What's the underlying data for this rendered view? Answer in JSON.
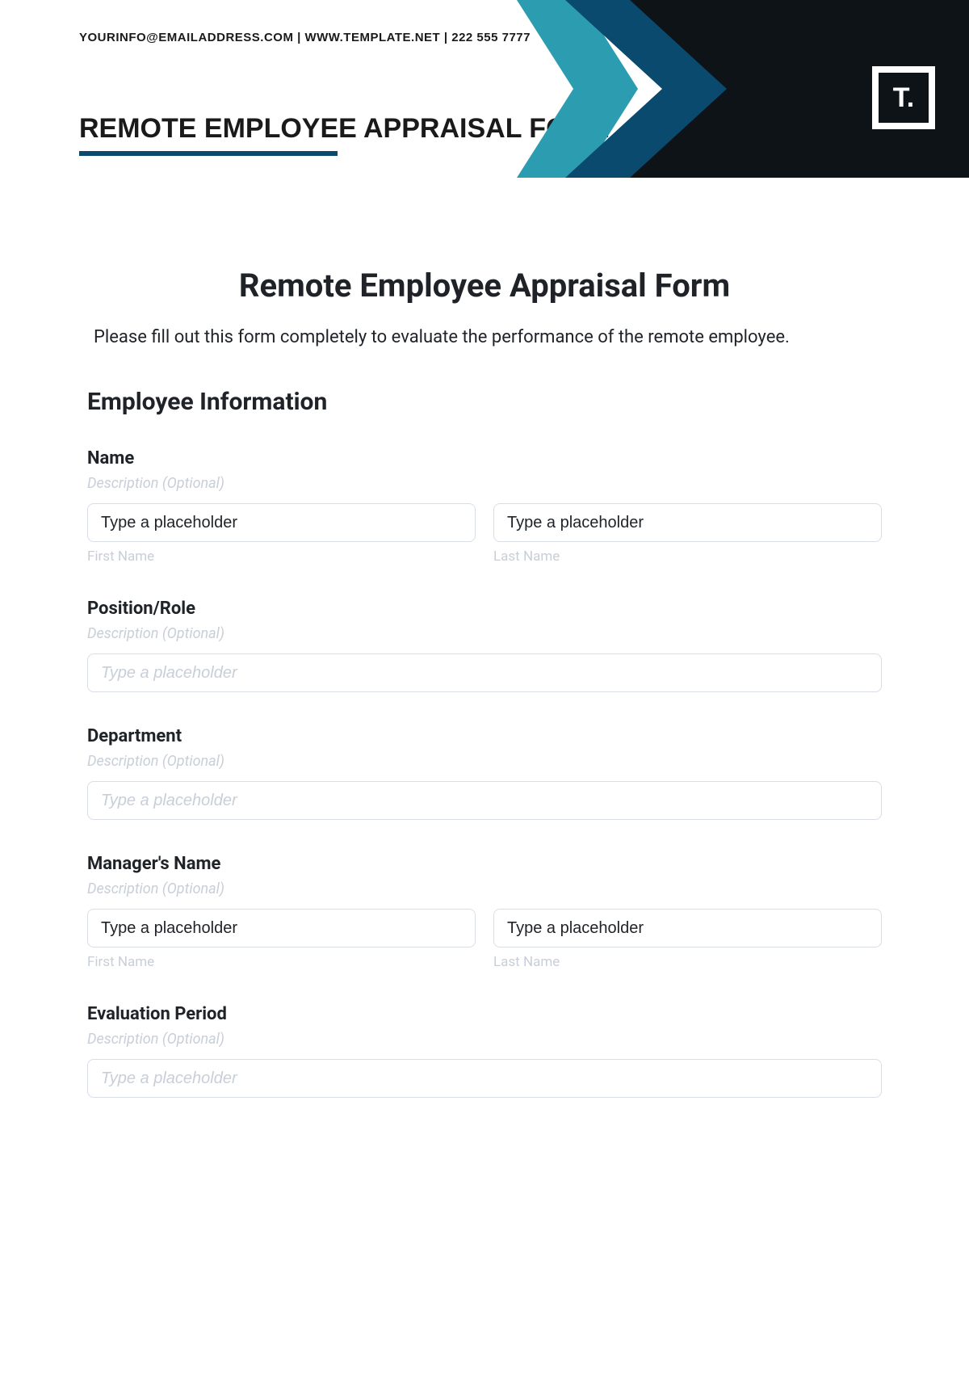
{
  "header": {
    "contact": "YOURINFO@EMAILADDRESS.COM  |  WWW.TEMPLATE.NET  |  222 555 7777",
    "title": "REMOTE EMPLOYEE APPRAISAL FORM",
    "logo": "T."
  },
  "form": {
    "title": "Remote Employee Appraisal Form",
    "intro": "Please fill out this form completely to evaluate the performance of the remote employee.",
    "section1": "Employee Information",
    "desc_text": "Description (Optional)",
    "placeholder_text": "Type a placeholder",
    "sublabel_first": "First Name",
    "sublabel_last": "Last Name",
    "fields": {
      "name": "Name",
      "position": "Position/Role",
      "department": "Department",
      "manager": "Manager's Name",
      "period": "Evaluation Period"
    }
  }
}
